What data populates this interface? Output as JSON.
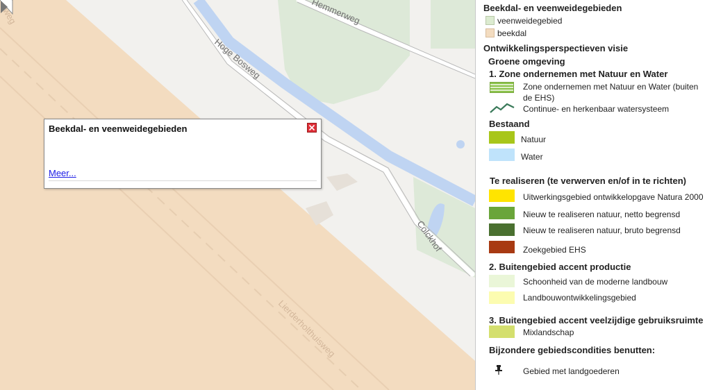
{
  "map": {
    "streets": {
      "top": "Hemmerweg",
      "hoge_bosweg": "Hoge Bosweg",
      "colckhof": "Colckhof",
      "lierderholthuisweg": "Lierderholthuisweg",
      "edge": "weg"
    },
    "arrow_icon": "triangle-right-icon"
  },
  "popup": {
    "title": "Beekdal- en veenweidegebieden",
    "link": "Meer...",
    "close_icon": "close-icon"
  },
  "legend": {
    "group1": {
      "title": "Beekdal- en veenweidegebieden",
      "items": [
        {
          "label": "veenweidegebied",
          "color": "#dcebd0"
        },
        {
          "label": "beekdal",
          "color": "#f3dcc0"
        }
      ]
    },
    "group2": {
      "title": "Ontwikkelingsperspectieven visie",
      "subtitle": "Groene omgeving",
      "zone1": {
        "title": "1. Zone ondernemen met Natuur en Water",
        "items": [
          {
            "label": "Zone ondernemen met Natuur en Water (buiten",
            "label2": "de EHS)",
            "color": "#8bc34a"
          },
          {
            "label": "Continue- en herkenbaar watersysteem",
            "icon": "zigzag-line-icon",
            "color": "#3a7a5a"
          }
        ]
      },
      "bestaand": {
        "title": "Bestaand",
        "items": [
          {
            "label": "Natuur",
            "color": "#a8c61a"
          },
          {
            "label": "Water",
            "color": "#bfe3fb"
          }
        ]
      },
      "te_realiseren": {
        "title": "Te realiseren (te verwerven en/of in te richten)",
        "items": [
          {
            "label": "Uitwerkingsgebied ontwikkelopgave Natura 2000",
            "color": "#ffe400"
          },
          {
            "label": "Nieuw te realiseren natuur, netto begrensd",
            "color": "#6aa53a"
          },
          {
            "label": "Nieuw te realiseren natuur, bruto begrensd",
            "color": "#4a7030"
          },
          {
            "label": "Zoekgebied EHS",
            "color": "#a83a12"
          }
        ]
      },
      "zone2": {
        "title": "2. Buitengebied accent productie",
        "items": [
          {
            "label": "Schoonheid van de moderne landbouw",
            "color": "#eaf6d8"
          },
          {
            "label": "Landbouwontwikkelingsgebied",
            "color": "#fcfcb0"
          }
        ]
      },
      "zone3": {
        "title": "3. Buitengebied accent veelzijdige gebruiksruimte",
        "items": [
          {
            "label": "Mixlandschap",
            "color": "#d4df6e"
          }
        ]
      },
      "bijzondere": {
        "title": "Bijzondere gebiedscondities benutten:",
        "items": [
          {
            "label": "Gebied met landgoederen",
            "icon": "pushpin-icon"
          }
        ]
      }
    }
  }
}
